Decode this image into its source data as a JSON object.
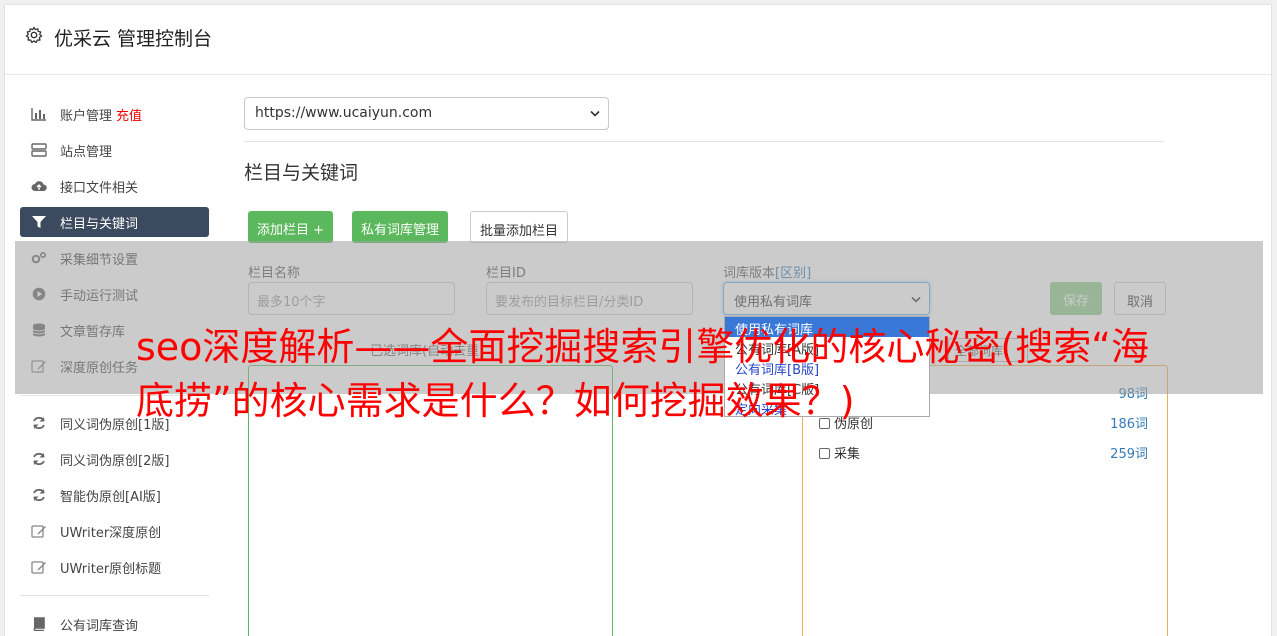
{
  "app": {
    "title": "优采云 管理控制台"
  },
  "sidebar": {
    "items": [
      {
        "label": "账户管理",
        "extra": "充值",
        "icon": "bar-chart-icon"
      },
      {
        "label": "站点管理",
        "icon": "server-icon"
      },
      {
        "label": "接口文件相关",
        "icon": "cloud-upload-icon"
      },
      {
        "label": "栏目与关键词",
        "icon": "filter-icon",
        "active": true
      },
      {
        "label": "采集细节设置",
        "icon": "gears-icon"
      },
      {
        "label": "手动运行测试",
        "icon": "play-circle-icon"
      },
      {
        "label": "文章暂存库",
        "icon": "database-icon"
      },
      {
        "label": "深度原创任务",
        "icon": "edit-icon"
      },
      {
        "label": "同义词伪原创[1版]",
        "icon": "refresh-icon"
      },
      {
        "label": "同义词伪原创[2版]",
        "icon": "refresh-icon"
      },
      {
        "label": "智能伪原创[AI版]",
        "icon": "refresh-icon"
      },
      {
        "label": "UWriter深度原创",
        "icon": "edit-icon"
      },
      {
        "label": "UWriter原创标题",
        "icon": "edit-icon"
      },
      {
        "label": "公有词库查询",
        "icon": "book-icon"
      }
    ]
  },
  "main": {
    "site_select_value": "https://www.ucaiyun.com",
    "section_title": "栏目与关键词",
    "buttons": {
      "add_column": "添加栏目 +",
      "private_lib": "私有词库管理",
      "batch_add": "批量添加栏目",
      "save": "保存",
      "cancel": "取消"
    },
    "form": {
      "name_label": "栏目名称",
      "name_placeholder": "最多10个字",
      "id_label": "栏目ID",
      "id_placeholder": "要发布的目标栏目/分类ID",
      "version_label": "词库版本",
      "version_label_accent": "[区别]",
      "version_value": "使用私有词库"
    },
    "dropdown_options": [
      "使用私有词库",
      "公有词库[A版]",
      "公有词库[B版]",
      "公有词库[C版]",
      "定向采集"
    ],
    "left_panel_header": "已选词库(自动去重)",
    "head_select_value": "全部词库",
    "library_rows": [
      {
        "label": "",
        "count": "98词"
      },
      {
        "label": "伪原创",
        "count": "186词"
      },
      {
        "label": "采集",
        "count": "259词"
      }
    ]
  },
  "overlay": {
    "text": "seo深度解析——全面挖掘搜索引擎优化的核心秘密(搜索“海底捞”的核心需求是什么？如何挖掘效果？)"
  },
  "colors": {
    "active_nav": "#3b4a5e",
    "green": "#5cb85c",
    "overlay_text": "#ff0000",
    "link": "#337ab7"
  }
}
